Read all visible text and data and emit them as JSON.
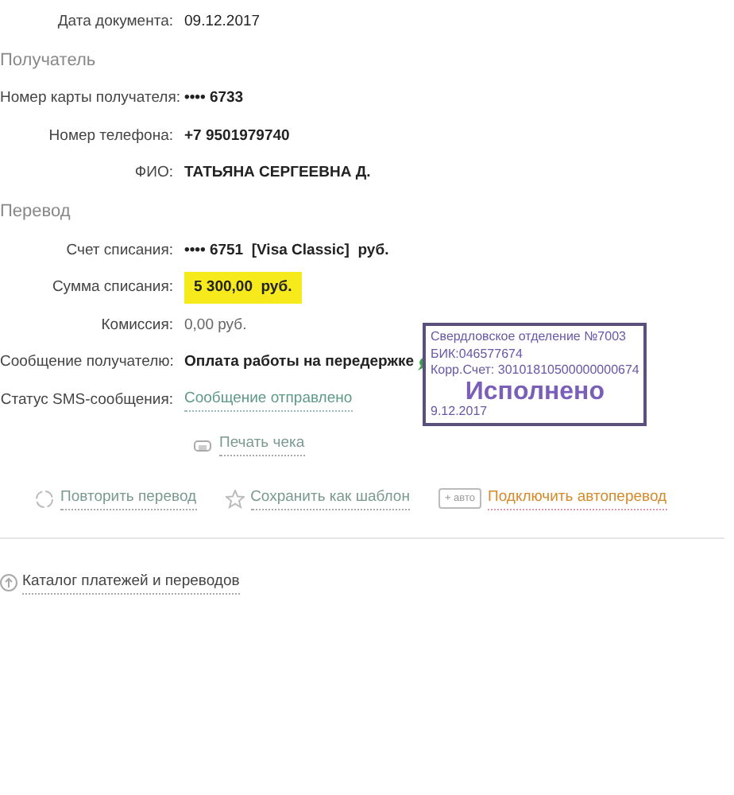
{
  "document_date": {
    "label": "Дата документа:",
    "value": "09.12.2017"
  },
  "sections": [
    {
      "title": "Получатель",
      "fields": [
        {
          "label": "Номер карты получателя:",
          "value": "•••• 6733",
          "kind": "bold"
        },
        {
          "label": "Номер телефона:",
          "value": "+7 9501979740",
          "kind": "bold"
        },
        {
          "label": "ФИО:",
          "value": "ТАТЬЯНА СЕРГЕЕВНА Д.",
          "kind": "bold"
        }
      ]
    },
    {
      "title": "Перевод",
      "fields": [
        {
          "label": "Счет списания:",
          "value": "•••• 6751  [Visa Classic]  руб.",
          "kind": "bold"
        },
        {
          "label": "Сумма списания:",
          "value": "5 300,00  руб.",
          "kind": "highlight"
        },
        {
          "label": "Комиссия:",
          "value": "0,00 руб.",
          "kind": "plain"
        },
        {
          "label": "Сообщение получателю:",
          "value": "Оплата работы на передержке",
          "kind": "message"
        },
        {
          "label": "Статус SMS-сообщения:",
          "value": "Сообщение отправлено",
          "kind": "link"
        }
      ]
    }
  ],
  "print_link": "Печать чека",
  "actions": [
    {
      "label": "Повторить перевод",
      "kind": "repeat"
    },
    {
      "label": "Сохранить как шаблон",
      "kind": "template"
    },
    {
      "label": "Подключить автоперевод",
      "kind": "auto",
      "badge": "+ авто"
    }
  ],
  "catalog_link": "Каталог платежей и переводов",
  "stamp": {
    "lines": [
      "Свердловское отделение №7003",
      "БИК:046577674",
      "Корр.Счет: 30101810500000000674"
    ],
    "status": "Исполнено",
    "date": "9.12.2017"
  }
}
